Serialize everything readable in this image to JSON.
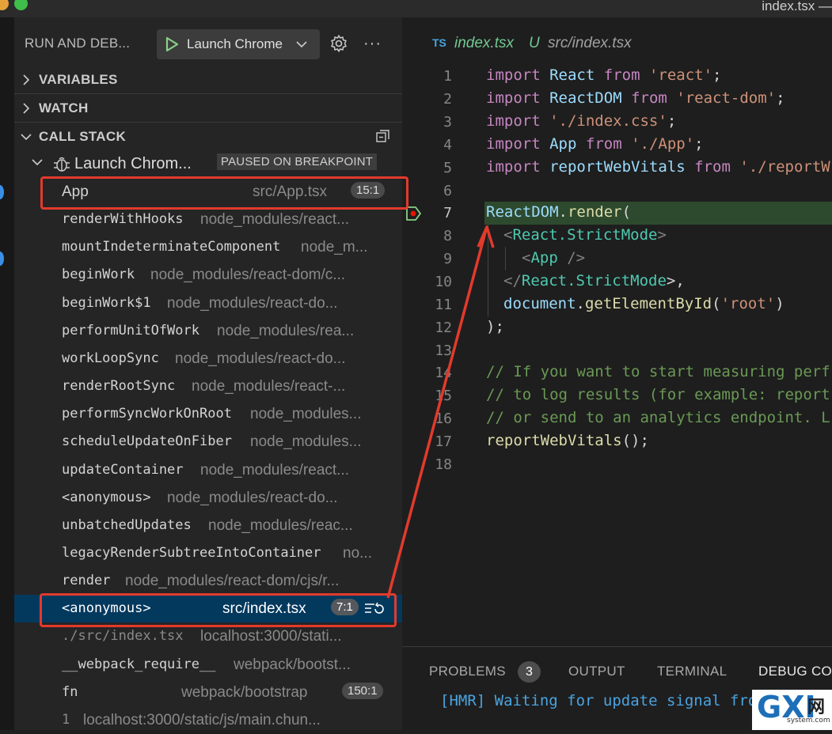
{
  "window": {
    "title": "index.tsx —"
  },
  "debug_header": {
    "title": "RUN AND DEB...",
    "config_label": "Launch Chrome"
  },
  "sections": {
    "variables": "VARIABLES",
    "watch": "WATCH",
    "call_stack": "CALL STACK"
  },
  "thread": {
    "label": "Launch Chrom...",
    "status": "PAUSED ON BREAKPOINT"
  },
  "frames": [
    {
      "fn": "App",
      "src": "src/App.tsx",
      "pos": "15:1"
    },
    {
      "fn": "renderWithHooks",
      "src": "node_modules/react..."
    },
    {
      "fn": "mountIndeterminateComponent",
      "src": "node_m..."
    },
    {
      "fn": "beginWork",
      "src": "node_modules/react-dom/c..."
    },
    {
      "fn": "beginWork$1",
      "src": "node_modules/react-do..."
    },
    {
      "fn": "performUnitOfWork",
      "src": "node_modules/rea..."
    },
    {
      "fn": "workLoopSync",
      "src": "node_modules/react-do..."
    },
    {
      "fn": "renderRootSync",
      "src": "node_modules/react-..."
    },
    {
      "fn": "performSyncWorkOnRoot",
      "src": "node_modules..."
    },
    {
      "fn": "scheduleUpdateOnFiber",
      "src": "node_modules..."
    },
    {
      "fn": "updateContainer",
      "src": "node_modules/react..."
    },
    {
      "fn": "<anonymous>",
      "src": "node_modules/react-do..."
    },
    {
      "fn": "unbatchedUpdates",
      "src": "node_modules/reac..."
    },
    {
      "fn": "legacyRenderSubtreeIntoContainer",
      "src": "no..."
    },
    {
      "fn": "render",
      "src": "node_modules/react-dom/cjs/r..."
    },
    {
      "fn": "<anonymous>",
      "src": "src/index.tsx",
      "pos": "7:1"
    },
    {
      "fn": "./src/index.tsx",
      "src": "localhost:3000/stati..."
    },
    {
      "fn": "__webpack_require__",
      "src": "webpack/bootst..."
    },
    {
      "fn": "fn",
      "src": "webpack/bootstrap",
      "pos": "150:1"
    },
    {
      "fn": "1",
      "src": "localhost:3000/static/js/main.chun..."
    }
  ],
  "editor_tab": {
    "lang": "TS",
    "filename": "index.tsx",
    "status": "U",
    "path": "src/index.tsx"
  },
  "line_numbers": [
    "1",
    "2",
    "3",
    "4",
    "5",
    "6",
    "7",
    "8",
    "9",
    "10",
    "11",
    "12",
    "13",
    "14",
    "15",
    "16",
    "17",
    "18"
  ],
  "code": {
    "l1": {
      "kw": "import",
      "id": "React",
      "from": "from",
      "str": "'react'",
      "end": ";"
    },
    "l2": {
      "kw": "import",
      "id": "ReactDOM",
      "from": "from",
      "str": "'react-dom'",
      "end": ";"
    },
    "l3": {
      "kw": "import",
      "str": "'./index.css'",
      "end": ";"
    },
    "l4": {
      "kw": "import",
      "id": "App",
      "from": "from",
      "str": "'./App'",
      "end": ";"
    },
    "l5": {
      "kw": "import",
      "id": "reportWebVitals",
      "from": "from",
      "str": "'./reportW"
    },
    "l7": {
      "obj": "ReactDOM",
      "dot": ".",
      "fn": "render",
      "paren": "("
    },
    "l8": {
      "open": "<",
      "tag": "React.StrictMode",
      "close": ">"
    },
    "l9": {
      "open": "<",
      "tag": "App",
      "close": " />"
    },
    "l10": {
      "open": "</",
      "tag": "React.StrictMode",
      "close": ">,"
    },
    "l11": {
      "obj": "document",
      "dot": ".",
      "fn": "getElementById",
      "paren": "(",
      "str": "'root'",
      "end": ")"
    },
    "l12": {
      "text": ");"
    },
    "l14": {
      "text": "// If you want to start measuring perf"
    },
    "l15": {
      "text": "// to log results (for example: report"
    },
    "l16": {
      "text": "// or send to an analytics endpoint. L"
    },
    "l17": {
      "fn": "reportWebVitals",
      "end": "();"
    }
  },
  "panel": {
    "tabs": {
      "problems": "PROBLEMS",
      "output": "OUTPUT",
      "terminal": "TERMINAL",
      "debug_console": "DEBUG CO"
    },
    "problem_count": "3",
    "console_line": "[HMR] Waiting for update signal fro"
  },
  "watermark": {
    "brand": "GXI",
    "net": "网",
    "site": "system.com"
  },
  "colors": {
    "accent": "#04395e",
    "annotation": "#e23a2c",
    "paused_green": "#2e4a2e"
  },
  "icons": [
    "play-icon",
    "chevron-down-icon",
    "gear-icon",
    "more-icon",
    "chevron-right-icon",
    "collapse-all-icon",
    "bug-icon",
    "restart-frame-icon",
    "breakpoint-arrow-icon"
  ]
}
